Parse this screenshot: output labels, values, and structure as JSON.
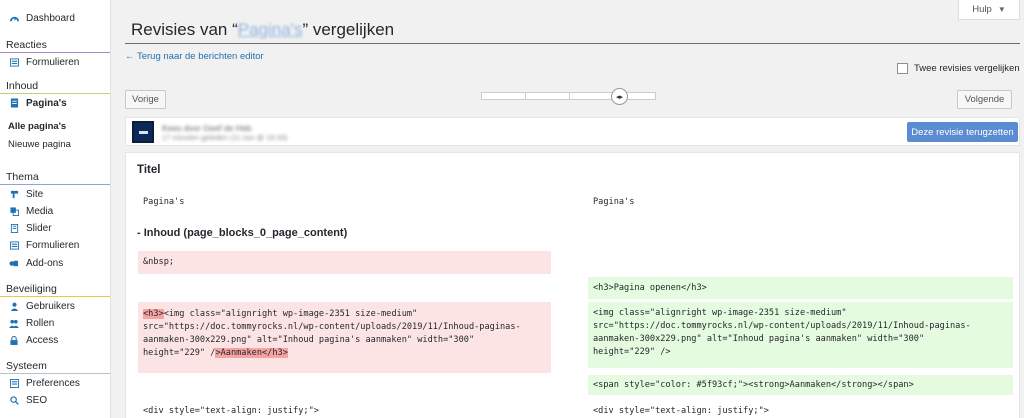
{
  "sidebar": {
    "dashboard": "Dashboard",
    "sections": {
      "reacties": "Reacties",
      "inhoud": "Inhoud",
      "thema": "Thema",
      "beveiliging": "Beveiliging",
      "systeem": "Systeem"
    },
    "reacties_items": [
      "Formulieren"
    ],
    "inhoud_active": "Pagina's",
    "inhoud_sub": [
      "Alle pagina's",
      "Nieuwe pagina"
    ],
    "thema_items": [
      "Site",
      "Media",
      "Slider",
      "Formulieren",
      "Add-ons"
    ],
    "beveiliging_items": [
      "Gebruikers",
      "Rollen",
      "Access"
    ],
    "systeem_items": [
      "Preferences",
      "SEO"
    ]
  },
  "header": {
    "help": "Hulp",
    "title_prefix": "Revisies van “",
    "title_blurred": "Pagina's",
    "title_suffix": "” vergelijken",
    "back_link": "← Terug naar de berichten editor",
    "compare_label": "Twee revisies vergelijken"
  },
  "nav": {
    "prev": "Vorige",
    "next": "Volgende",
    "slider_position": 0.8
  },
  "revision": {
    "author_blurred": "Kees door Geef de Heb",
    "time_blurred": "17 minuten geleden (11 nov @ 16:33)",
    "restore": "Deze revisie terugzetten"
  },
  "diff": {
    "title_label": "Titel",
    "title_left": "Pagina's",
    "title_right": "Pagina's",
    "field_label": "- Inhoud (page_blocks_0_page_content)",
    "del1": "&nbsp;",
    "del2_hl_start": "<h3>",
    "del2_line1_rest": "<img class=\"alignright wp-image-2351 size-medium\"",
    "del2_line2": "src=\"https://doc.tommyrocks.nl/wp-content/uploads/2019/11/Inhoud-paginas-",
    "del2_line3": "aanmaken-300x229.png\" alt=\"Inhoud pagina's aanmaken\" width=\"300\"",
    "del2_line4_pre": "height=\"229\" /",
    "del2_hl_end": ">Aanmaken</h3>",
    "ins1": "<h3>Pagina openen</h3>",
    "ins2": "<img class=\"alignright wp-image-2351 size-medium\"\nsrc=\"https://doc.tommyrocks.nl/wp-content/uploads/2019/11/Inhoud-paginas-\naanmaken-300x229.png\" alt=\"Inhoud pagina's aanmaken\" width=\"300\"\nheight=\"229\" />",
    "ins3": "<span style=\"color: #5f93cf;\"><strong>Aanmaken</strong></span>",
    "tail_left": "<div style=\"text-align: justify;\">",
    "tail_right": "<div style=\"text-align: justify;\">"
  }
}
